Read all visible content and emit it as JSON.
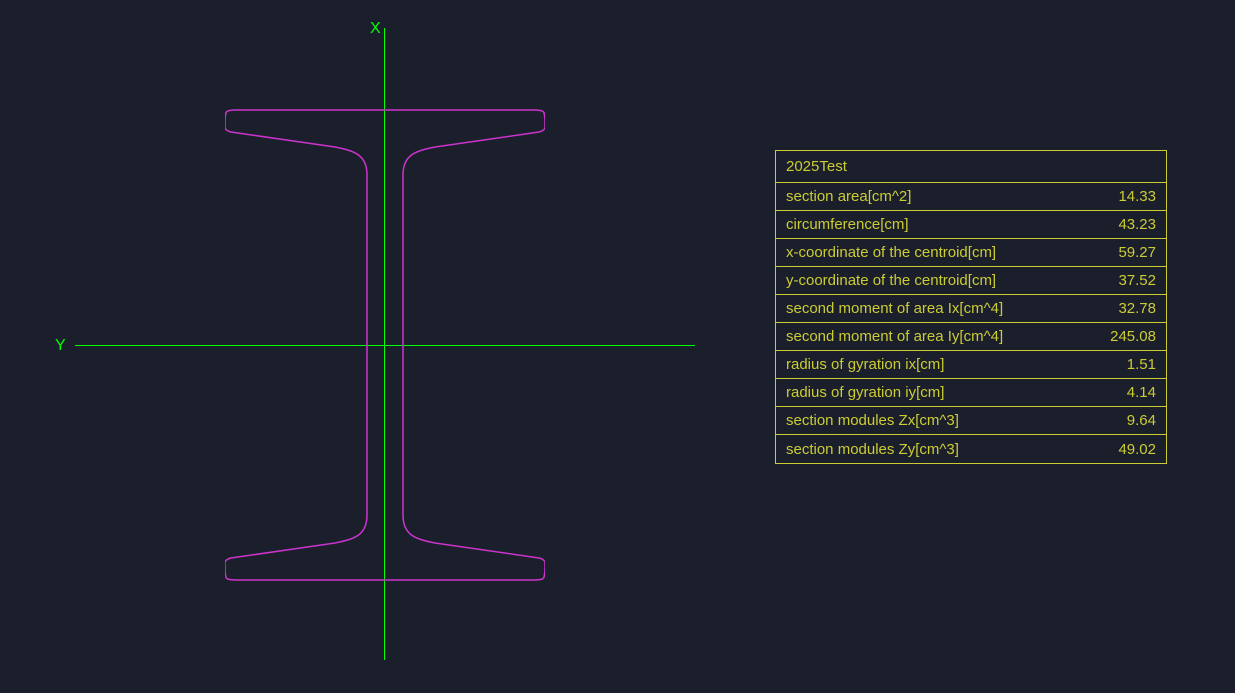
{
  "axes": {
    "x_label": "X",
    "y_label": "Y"
  },
  "table": {
    "title": "2025Test",
    "rows": [
      {
        "label": "section area[cm^2]",
        "value": "14.33"
      },
      {
        "label": "circumference[cm]",
        "value": "43.23"
      },
      {
        "label": "x-coordinate of the centroid[cm]",
        "value": "59.27"
      },
      {
        "label": "y-coordinate of the centroid[cm]",
        "value": "37.52"
      },
      {
        "label": "second moment of area Ix[cm^4]",
        "value": "32.78"
      },
      {
        "label": "second moment of area Iy[cm^4]",
        "value": "245.08"
      },
      {
        "label": "radius of gyration ix[cm]",
        "value": "1.51"
      },
      {
        "label": "radius of gyration iy[cm]",
        "value": "4.14"
      },
      {
        "label": "section modules Zx[cm^3]",
        "value": "9.64"
      },
      {
        "label": "section modules Zy[cm^3]",
        "value": "49.02"
      }
    ]
  },
  "colors": {
    "background": "#1a1f2b",
    "axis": "#00ff00",
    "beam": "#cc33cc",
    "table": "#cccc33"
  }
}
